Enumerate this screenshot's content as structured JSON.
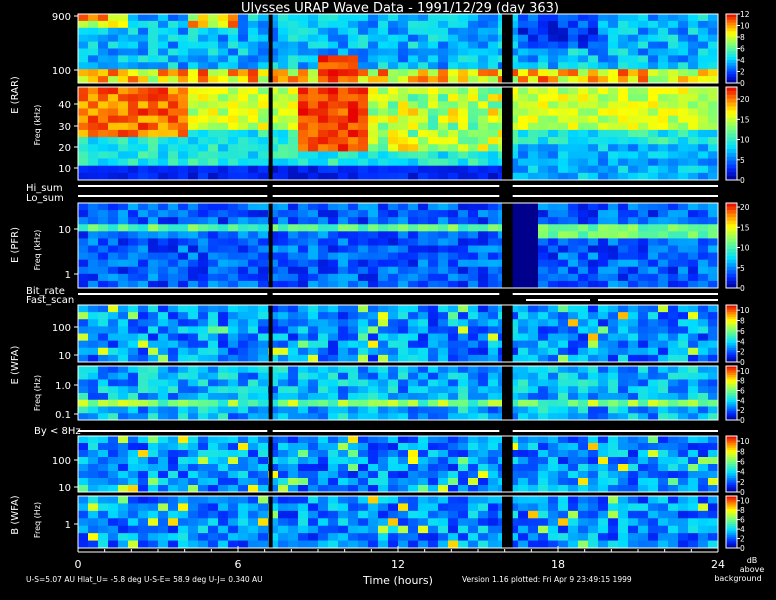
{
  "chart_data": {
    "type": "heatmap",
    "title": "Ulysses URAP Wave Data - 1991/12/29  (day 363)",
    "xlabel": "Time (hours)",
    "x_ticks": [
      "0",
      "6",
      "12",
      "18",
      "24"
    ],
    "xlim": [
      0,
      24
    ],
    "group_labels": [
      "E (RAR)",
      "E (PFR)",
      "E (WFA)",
      "B (WFA)"
    ],
    "freq_axis_label": "Freq (kHz)",
    "freq_axis_label_hz": "Freq (Hz)",
    "status_strips": [
      {
        "name": "Hi_sum"
      },
      {
        "name": "Lo_sum"
      },
      {
        "name": "Bit_rate"
      },
      {
        "name": "Fast_scan"
      },
      {
        "name": "By < 8Hz"
      }
    ],
    "panels": [
      {
        "id": "rar-high",
        "y_ticks": [
          "900",
          "100"
        ],
        "colorbar_ticks": [
          "12",
          "10",
          "8",
          "6",
          "4",
          "2",
          "0"
        ],
        "colorbar_max": 12
      },
      {
        "id": "rar-low",
        "y_ticks": [
          "40",
          "30",
          "20",
          "10"
        ],
        "colorbar_ticks": [
          "20",
          "15",
          "10",
          "5",
          "0"
        ],
        "colorbar_max": 23
      },
      {
        "id": "pfr",
        "y_ticks": [
          "10",
          "1"
        ],
        "colorbar_ticks": [
          "20",
          "15",
          "10",
          "5",
          "0"
        ],
        "colorbar_max": 21
      },
      {
        "id": "wfa-e-high",
        "y_ticks": [
          "100",
          "10"
        ],
        "colorbar_ticks": [
          "10",
          "8",
          "6",
          "4",
          "2",
          "0"
        ],
        "colorbar_max": 11
      },
      {
        "id": "wfa-e-low",
        "y_ticks": [
          "1.0",
          "0.1"
        ],
        "colorbar_ticks": [
          "10",
          "8",
          "6",
          "4",
          "2",
          "0"
        ],
        "colorbar_max": 11
      },
      {
        "id": "wfa-b-high",
        "y_ticks": [
          "100",
          "10"
        ],
        "colorbar_ticks": [
          "10",
          "8",
          "6",
          "4",
          "2",
          "0"
        ],
        "colorbar_max": 11
      },
      {
        "id": "wfa-b-low",
        "y_ticks": [
          "1"
        ],
        "colorbar_ticks": [
          "10",
          "8",
          "6",
          "4",
          "2",
          "0"
        ],
        "colorbar_max": 11
      }
    ],
    "data_gaps_hours": [
      [
        7.15,
        7.3
      ],
      [
        15.9,
        16.3
      ]
    ],
    "colorbar_unit": [
      "dB",
      "above",
      "background"
    ]
  },
  "footer": {
    "left": "U-S=5.07 AU  Hlat_U= -5.8 deg  U-S-E= 58.9 deg  U-J= 0.340 AU",
    "right": "Version 1.16 plotted: Fri Apr  9 23:49:15 1999"
  }
}
